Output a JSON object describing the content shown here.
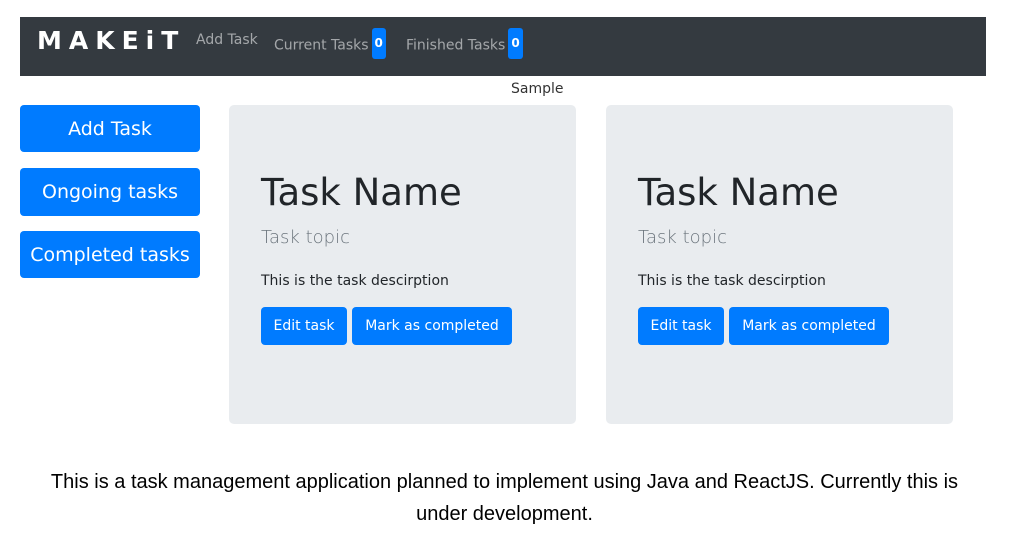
{
  "navbar": {
    "brand": "MAKEiT",
    "links": {
      "add_task": "Add Task",
      "current_tasks": "Current Tasks",
      "current_count": "0",
      "finished_tasks": "Finished Tasks",
      "finished_count": "0"
    },
    "background": "#343a40"
  },
  "sample_label": "Sample",
  "sidebar": {
    "buttons": [
      {
        "label": "Add Task"
      },
      {
        "label": "Ongoing tasks"
      },
      {
        "label": "Completed tasks"
      }
    ]
  },
  "cards": [
    {
      "title": "Task Name",
      "topic": "Task topic",
      "description": "This is the task descirption",
      "edit_label": "Edit task",
      "complete_label": "Mark as completed"
    },
    {
      "title": "Task Name",
      "topic": "Task topic",
      "description": "This is the task descirption",
      "edit_label": "Edit task",
      "complete_label": "Mark as completed"
    }
  ],
  "footer": {
    "line1": "This is a task management application planned to implement using Java and ReactJS. Currently this is",
    "line2": "under development."
  },
  "colors": {
    "primary": "#007bff",
    "card_bg": "#e9ecef"
  }
}
